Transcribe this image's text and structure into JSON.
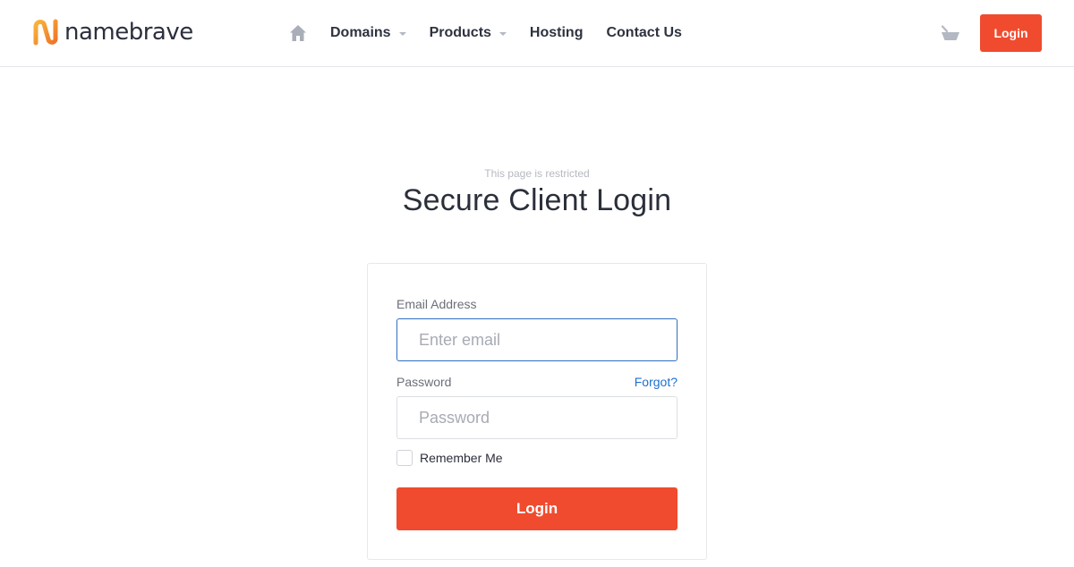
{
  "brand": {
    "name": "namebrave",
    "logo_gradient": [
      "#f7b23b",
      "#f07a2a"
    ]
  },
  "nav": {
    "home_icon": "home-icon",
    "items": [
      {
        "label": "Domains",
        "has_dropdown": true
      },
      {
        "label": "Products",
        "has_dropdown": true
      },
      {
        "label": "Hosting",
        "has_dropdown": false
      },
      {
        "label": "Contact Us",
        "has_dropdown": false
      }
    ],
    "cart_icon": "cart-icon",
    "login_label": "Login"
  },
  "page": {
    "eyebrow": "This page is restricted",
    "title": "Secure Client Login"
  },
  "form": {
    "email_label": "Email Address",
    "email_placeholder": "Enter email",
    "email_value": "",
    "password_label": "Password",
    "forgot_label": "Forgot?",
    "password_placeholder": "Password",
    "password_value": "",
    "remember_label": "Remember Me",
    "remember_checked": false,
    "submit_label": "Login"
  },
  "colors": {
    "accent": "#f04b2f",
    "link": "#1f6fd0",
    "focus_border": "#2f6fc1"
  }
}
